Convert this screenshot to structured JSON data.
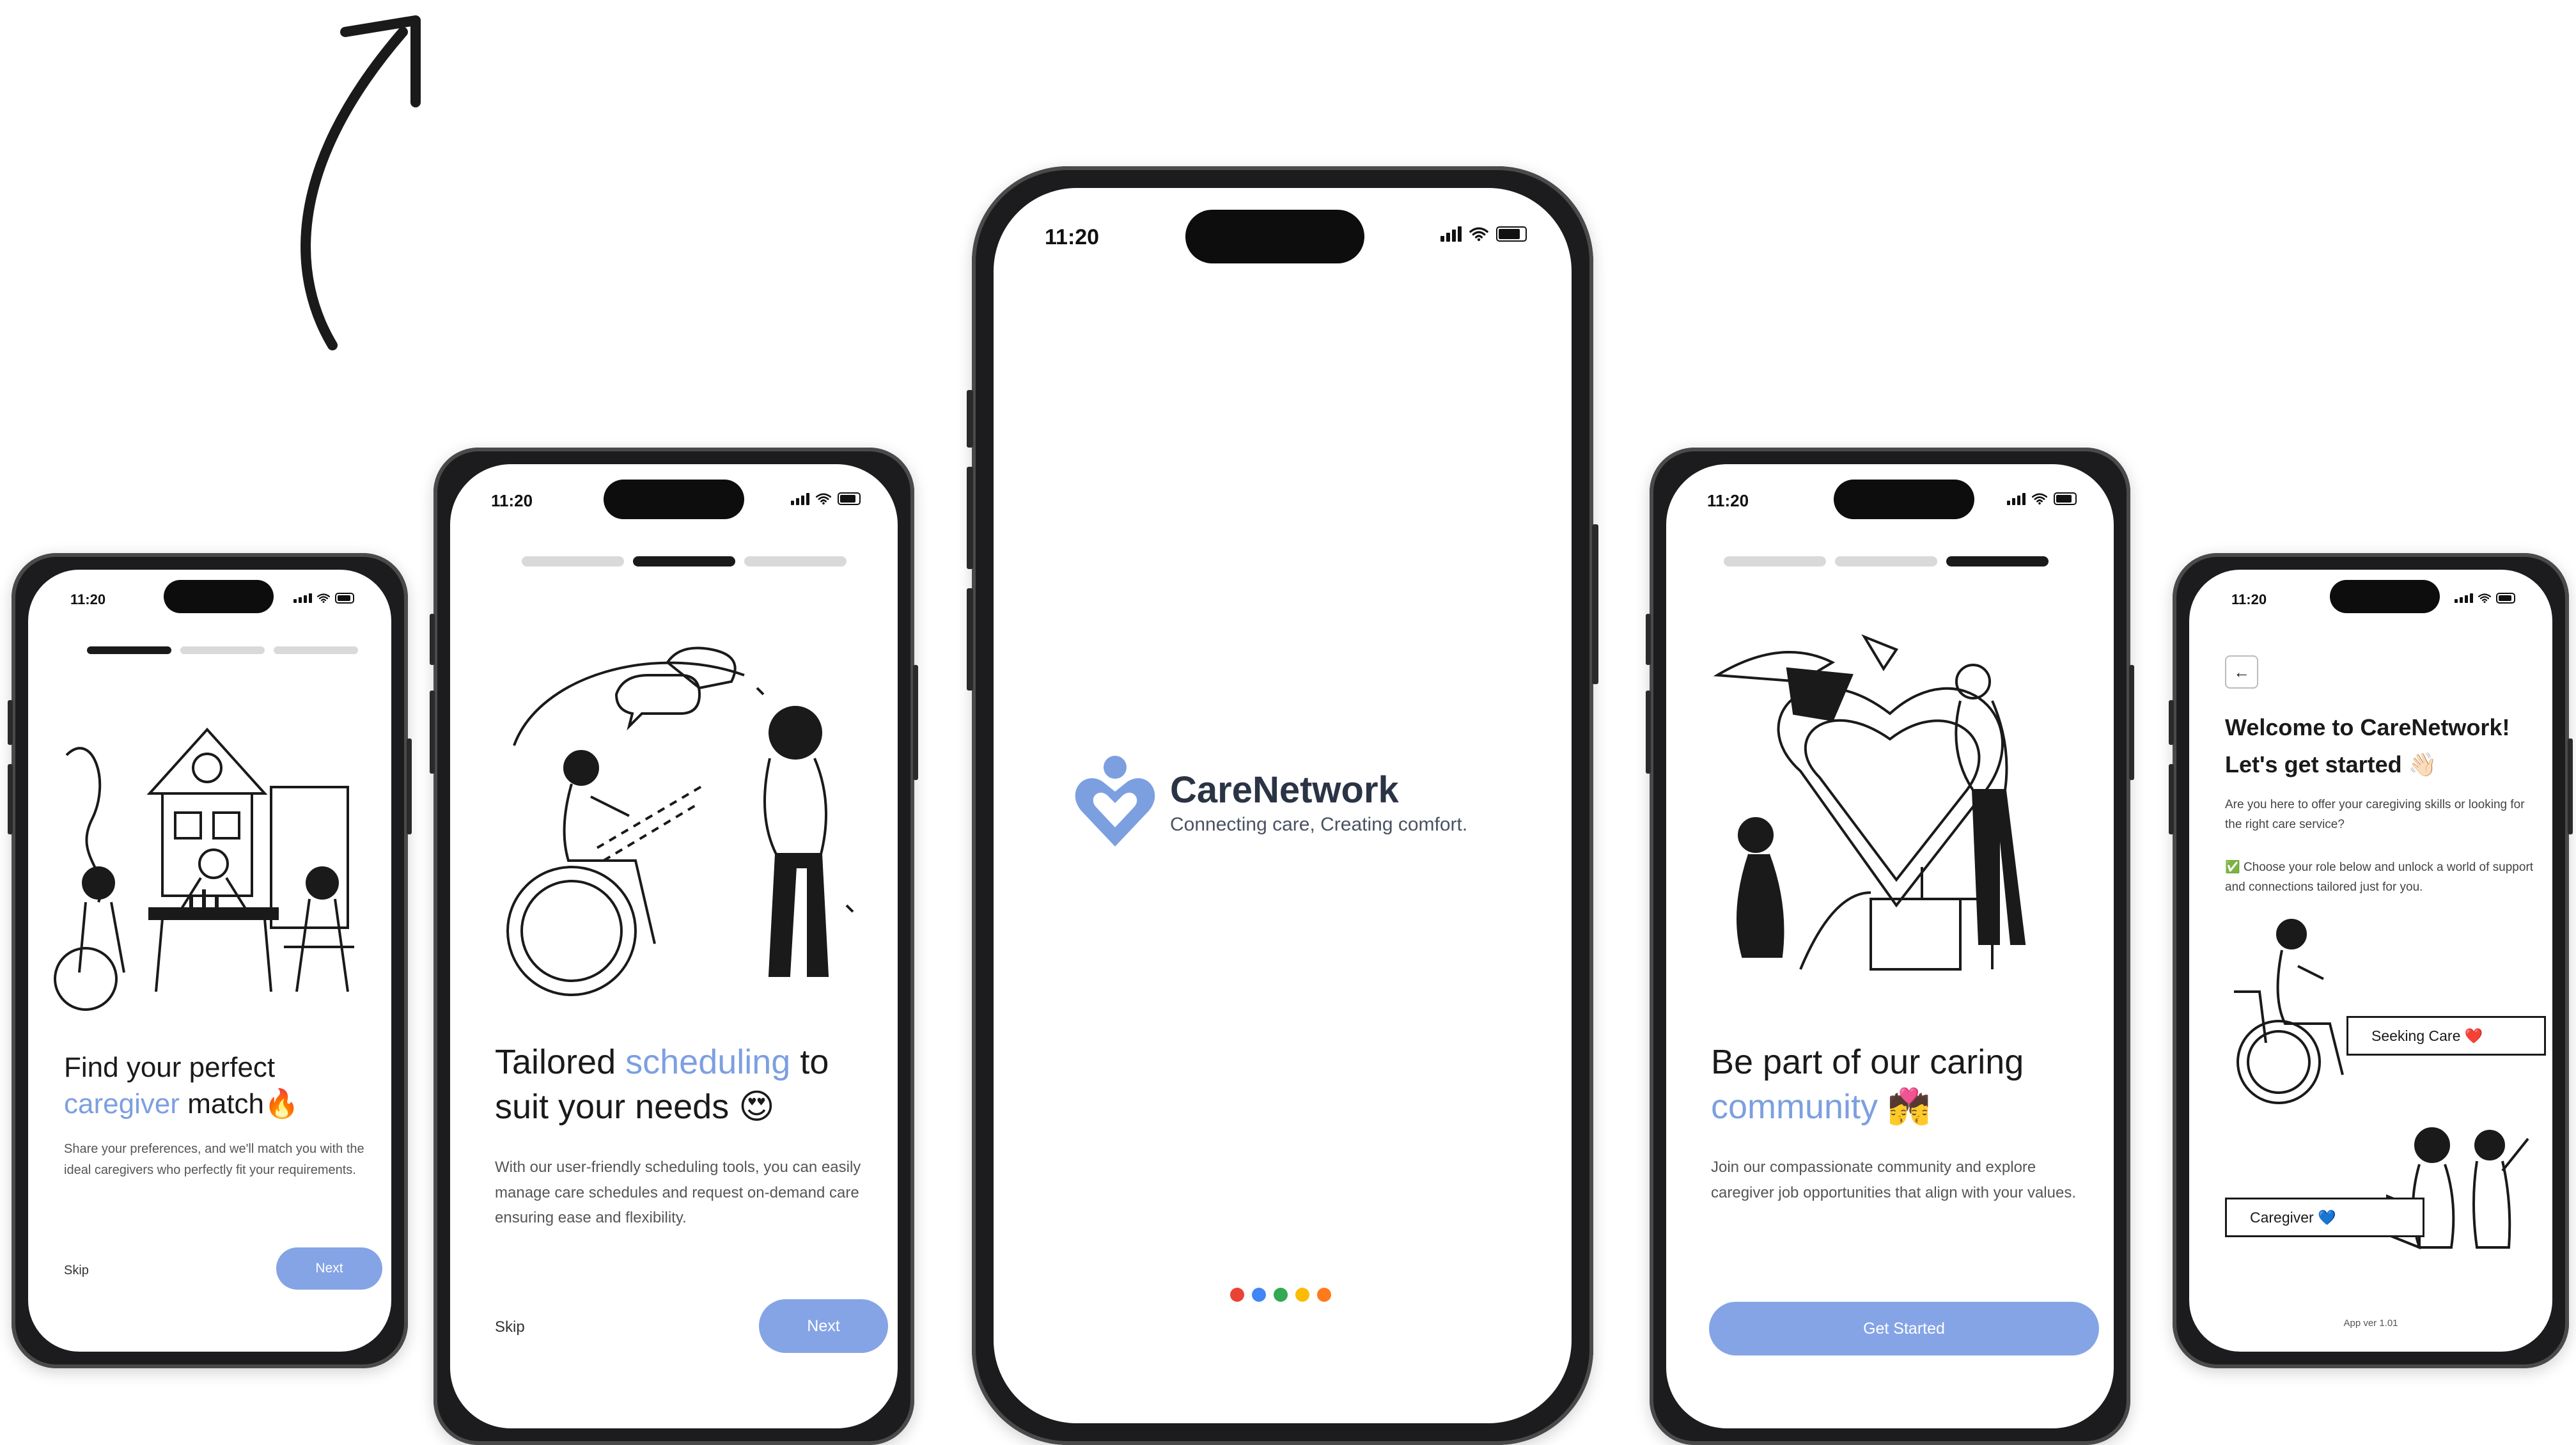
{
  "status": {
    "time": "11:20"
  },
  "onboarding_1": {
    "title_line1": "Find your perfect",
    "title_accent": "caregiver",
    "title_rest": "match",
    "title_emoji": "🔥",
    "body": "Share your preferences, and we'll match you with the ideal caregivers who perfectly fit your requirements.",
    "skip_label": "Skip",
    "next_label": "Next"
  },
  "onboarding_2": {
    "title_pre": "Tailored",
    "title_accent": "scheduling",
    "title_post": "to",
    "title_line2": "suit your needs",
    "title_emoji": "😍",
    "body": "With our user-friendly scheduling tools, you can easily manage care schedules and request on-demand care ensuring ease and flexibility.",
    "skip_label": "Skip",
    "next_label": "Next"
  },
  "splash": {
    "brand_name": "CareNetwork",
    "tagline": "Connecting care, Creating comfort.",
    "loader_colors": [
      "#ea4335",
      "#4285f4",
      "#34a853",
      "#fbbc05",
      "#ff7a1a"
    ]
  },
  "onboarding_3": {
    "title_line1": "Be part of our caring",
    "title_accent": "community",
    "title_emoji": "💏",
    "body": "Join our compassionate community and explore caregiver job opportunities that align with your values.",
    "cta_label": "Get Started"
  },
  "welcome": {
    "back_icon": "←",
    "title_line1": "Welcome to CareNetwork!",
    "title_line2": "Let's get started",
    "title_emoji": "👋🏻",
    "intro": "Are you here to offer your caregiving skills or looking for the right care service?",
    "instruction_emoji": "✅",
    "instruction": "Choose your role below and unlock a world of support and connections tailored just for you.",
    "role_seeking_label": "Seeking Care",
    "role_seeking_emoji": "❤️",
    "role_caregiver_label": "Caregiver",
    "role_caregiver_emoji": "💙",
    "app_version": "App ver 1.01"
  },
  "colors": {
    "accent": "#7c9fe0",
    "button": "#85a4e6",
    "frame": "#1c1c1e"
  }
}
